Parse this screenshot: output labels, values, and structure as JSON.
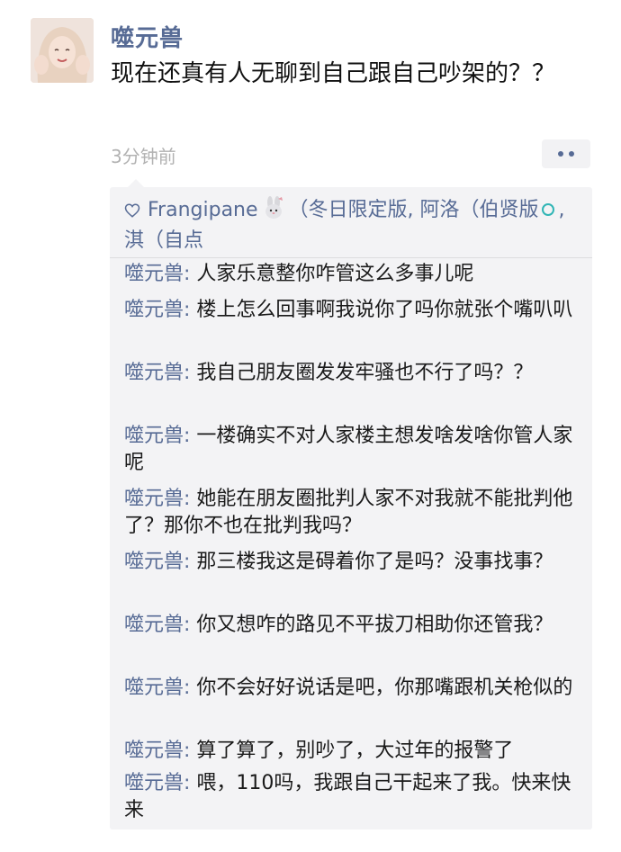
{
  "post": {
    "author": "噬元兽",
    "text": "现在还真有人无聊到自己跟自己吵架的？？",
    "time": "3分钟前"
  },
  "likes": {
    "part1": "Frangipane",
    "part2": "（冬日限定版, 阿洛（伯贤版",
    "part3": ", 淇（自点",
    "icons": [
      "heart-outline-icon",
      "bunny-emoji-icon",
      "ring-emoji-icon"
    ]
  },
  "comments": [
    {
      "name": "噬元兽",
      "text": "人家乐意整你咋管这么多事儿呢"
    },
    {
      "name": "噬元兽",
      "text": "楼上怎么回事啊我说你了吗你就张个嘴叭叭"
    },
    {
      "name": "噬元兽",
      "text": "我自己朋友圈发发牢骚也不行了吗？？"
    },
    {
      "name": "噬元兽",
      "text": "一楼确实不对人家楼主想发啥发啥你管人家呢"
    },
    {
      "name": "噬元兽",
      "text": "她能在朋友圈批判人家不对我就不能批判他了？那你不也在批判我吗？"
    },
    {
      "name": "噬元兽",
      "text": "那三楼我这是碍着你了是吗？没事找事？"
    },
    {
      "name": "噬元兽",
      "text": "你又想咋的路见不平拔刀相助你还管我？"
    },
    {
      "name": "噬元兽",
      "text": "你不会好好说话是吧，你那嘴跟机关枪似的"
    },
    {
      "name": "噬元兽",
      "text": "算了算了，别吵了，大过年的报警了"
    },
    {
      "name": "噬元兽",
      "text": "喂，110吗，我跟自己干起来了我。快来快来"
    }
  ],
  "colors": {
    "link": "#576b95",
    "text": "#1a1a1a",
    "time": "#b2b2b2",
    "comment_bg": "#f3f3f5"
  }
}
